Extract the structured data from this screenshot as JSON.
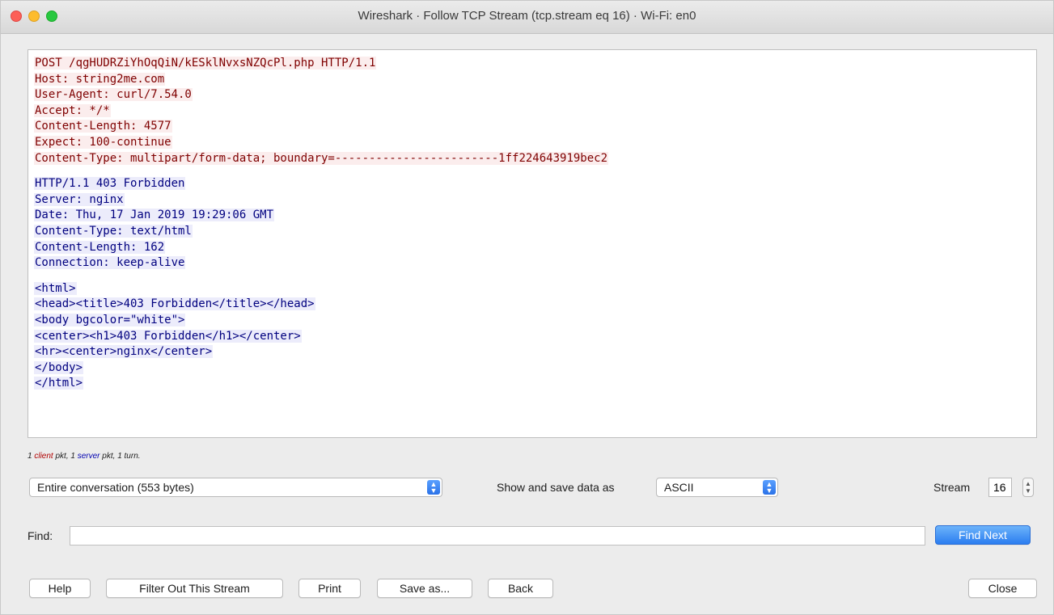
{
  "window": {
    "title": "Wireshark · Follow TCP Stream (tcp.stream eq 16) · Wi-Fi: en0"
  },
  "stream": {
    "client_lines": [
      "POST /qgHUDRZiYhOqQiN/kESklNvxsNZQcPl.php HTTP/1.1",
      "Host: string2me.com",
      "User-Agent: curl/7.54.0",
      "Accept: */*",
      "Content-Length: 4577",
      "Expect: 100-continue",
      "Content-Type: multipart/form-data; boundary=------------------------1ff224643919bec2"
    ],
    "server_header_lines": [
      "HTTP/1.1 403 Forbidden",
      "Server: nginx",
      "Date: Thu, 17 Jan 2019 19:29:06 GMT",
      "Content-Type: text/html",
      "Content-Length: 162",
      "Connection: keep-alive"
    ],
    "server_body_lines": [
      "<html>",
      "<head><title>403 Forbidden</title></head>",
      "<body bgcolor=\"white\">",
      "<center><h1>403 Forbidden</h1></center>",
      "<hr><center>nginx</center>",
      "</body>",
      "</html>"
    ]
  },
  "summary": {
    "prefix": "1 ",
    "client_word": "client",
    "middle": " pkt, 1 ",
    "server_word": "server",
    "suffix": " pkt, 1 turn."
  },
  "controls": {
    "conversation_select": "Entire conversation (553 bytes)",
    "show_save_label": "Show and save data as",
    "format_select": "ASCII",
    "stream_label": "Stream",
    "stream_value": "16",
    "find_label": "Find:",
    "find_value": "",
    "find_next_label": "Find Next"
  },
  "buttons": {
    "help": "Help",
    "filter_out": "Filter Out This Stream",
    "print": "Print",
    "save_as": "Save as...",
    "back": "Back",
    "close": "Close"
  },
  "colors": {
    "client_text": "#7f0000",
    "client_bg": "#fbeded",
    "server_text": "#00007f",
    "server_bg": "#ececfb",
    "accent": "#2b7df0"
  }
}
